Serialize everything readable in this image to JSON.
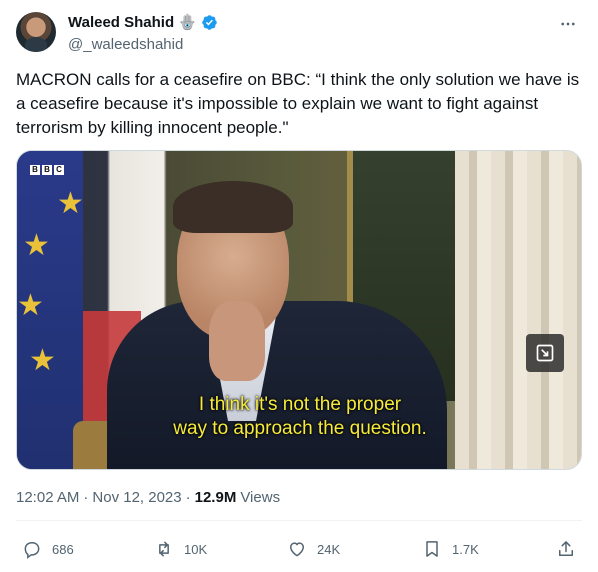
{
  "author": {
    "display_name": "Waleed Shahid",
    "badge_emoji": "🪬",
    "handle": "@_waleedshahid"
  },
  "tweet": {
    "text": "MACRON calls for a ceasefire on BBC: “I think the only solution we have is a ceasefire because it's impossible to explain we want to fight against terrorism by killing innocent people.\""
  },
  "media": {
    "broadcaster": [
      "B",
      "B",
      "C"
    ],
    "subtitle": "I think it's not the proper\nway to approach the question."
  },
  "meta": {
    "time": "12:02 AM",
    "separator": "·",
    "date": "Nov 12, 2023",
    "views_count": "12.9M",
    "views_label": "Views"
  },
  "actions": {
    "replies": "686",
    "reposts": "10K",
    "likes": "24K",
    "bookmarks": "1.7K"
  },
  "colors": {
    "text_primary": "#0f1419",
    "text_secondary": "#536471",
    "verified_blue": "#1d9bf0",
    "subtitle_yellow": "#f6ea3a"
  },
  "icons": [
    "more-icon",
    "verified-icon",
    "expand-icon",
    "reply-icon",
    "repost-icon",
    "like-icon",
    "bookmark-icon",
    "share-icon"
  ]
}
